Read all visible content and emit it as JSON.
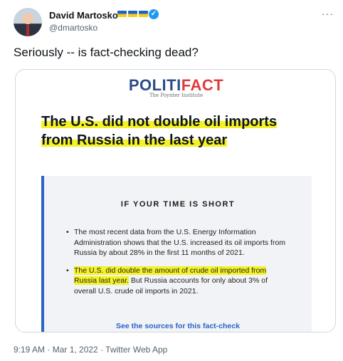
{
  "tweet": {
    "author_name": "David Martosko",
    "handle": "@dmartosko",
    "text": "Seriously -- is fact-checking dead?",
    "more_icon": "more-options-icon",
    "verified_icon": "verified-badge-icon",
    "flag_icon": "ukraine-flag-icon",
    "timestamp": "9:19 AM · Mar 1, 2022 · Twitter Web App"
  },
  "card": {
    "logo_part1": "POLITI",
    "logo_part2": "FACT",
    "logo_sub": "The Poynter Institute",
    "headline_line1": "The U.S. did not double oil imports",
    "headline_line2": "from Russia in the last year",
    "box_title": "IF YOUR TIME IS SHORT",
    "bullet1": "The most recent data from the U.S. Energy Information Administration shows that the U.S. increased its oil imports from Russia by about 28% in the first 11 months of 2021.",
    "bullet2_highlight": "The U.S. did double the amount of crude oil imported from Russia last year.",
    "bullet2_rest": " But Russia accounts for only about 3% of overall U.S. crude oil imports in 2021.",
    "sources_link": "See the sources for this fact-check"
  },
  "colors": {
    "politifact_blue": "#2b4d86",
    "politifact_red": "#e03a3e",
    "highlight_yellow": "#f4f226",
    "link_blue": "#2b63c6",
    "twitter_blue": "#1d9bf0"
  }
}
